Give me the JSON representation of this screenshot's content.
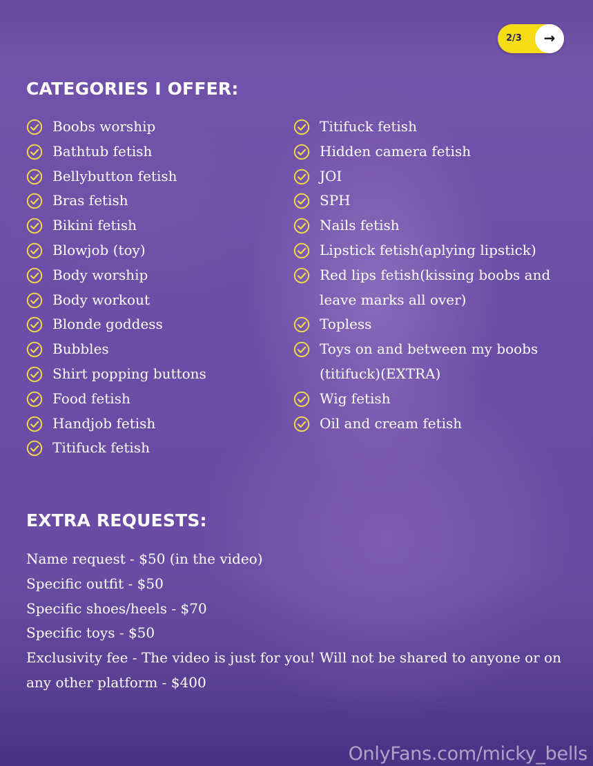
{
  "pager": {
    "count": "2/3",
    "next_icon": "arrow-right-icon"
  },
  "categories": {
    "heading": "CATEGORIES I OFFER:",
    "icon": "check-circle-icon",
    "check_color": "#f2d84a",
    "left": [
      "Boobs worship",
      "Bathtub fetish",
      "Bellybutton fetish",
      "Bras fetish",
      "Bikini fetish",
      "Blowjob (toy)",
      "Body worship",
      "Body workout",
      "Blonde goddess",
      "Bubbles",
      "Shirt popping buttons",
      "Food fetish",
      "Handjob fetish",
      "Titifuck fetish"
    ],
    "right": [
      "Titifuck fetish",
      "Hidden camera fetish",
      "JOI",
      "SPH",
      "Nails fetish",
      "Lipstick fetish(aplying lipstick)",
      "Red lips fetish(kissing boobs and leave marks all over)",
      "Topless",
      "Toys on and between my boobs (titifuck)(EXTRA)",
      "Wig fetish",
      "Oil and cream fetish"
    ]
  },
  "extra_requests": {
    "heading": "EXTRA REQUESTS:",
    "lines": [
      "Name request - $50 (in the video)",
      "Specific outfit - $50",
      "Specific shoes/heels - $70",
      "Specific toys - $50",
      "Exclusivity fee - The video is just for you! Will not be shared to anyone or on any other platform - $400"
    ]
  },
  "watermark": "OnlyFans.com/micky_bells",
  "colors": {
    "background": "#6d4fa8",
    "pager": "#f5dc14",
    "text": "#ffffff"
  }
}
